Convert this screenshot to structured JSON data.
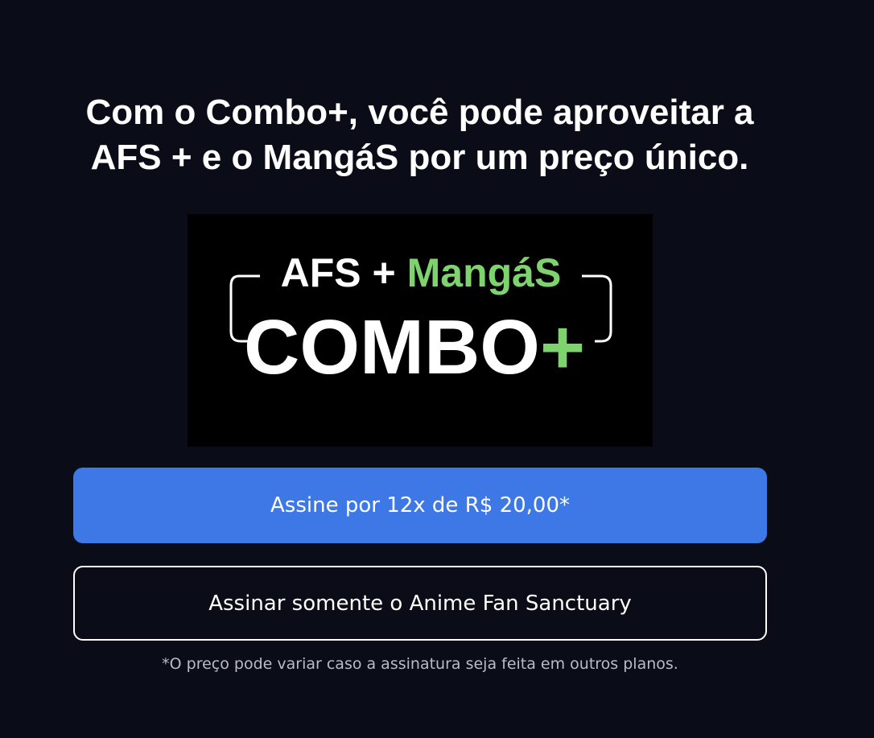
{
  "headline": {
    "line1": "Com o Combo+, você pode aproveitar a",
    "line2": "AFS + e o MangáS por um preço único."
  },
  "logo": {
    "top_left": "AFS + ",
    "top_right": "MangáS",
    "main_word": "COMBO",
    "plus": "+",
    "colors": {
      "white": "#ffffff",
      "green": "#7ed36f",
      "background": "#000000"
    }
  },
  "buttons": {
    "primary_label": "Assine por 12x de R$ 20,00*",
    "secondary_label": "Assinar somente o Anime Fan Sanctuary"
  },
  "disclaimer": "*O preço pode variar caso a assinatura seja feita em outros planos.",
  "colors": {
    "background": "#0a0d17",
    "primary": "#3d78e6",
    "disclaimer_text": "#b9bcc6"
  }
}
